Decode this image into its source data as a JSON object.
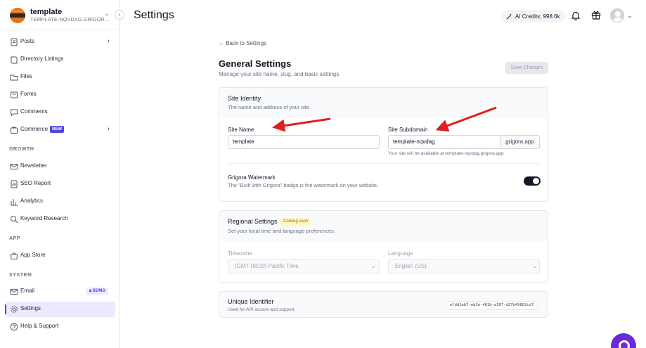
{
  "site": {
    "name": "template",
    "domain": "TEMPLATE-NQVDAG.GRIGOR..."
  },
  "nav": {
    "items_top": [
      {
        "label": "Posts",
        "icon": "posts-icon"
      },
      {
        "label": "Directory Listings",
        "icon": "book-icon"
      },
      {
        "label": "Files",
        "icon": "folder-icon"
      },
      {
        "label": "Forms",
        "icon": "forms-icon"
      },
      {
        "label": "Comments",
        "icon": "comment-icon"
      },
      {
        "label": "Commerce",
        "icon": "commerce-icon",
        "badge": "NEW"
      }
    ],
    "growth_label": "GROWTH",
    "growth": [
      {
        "label": "Newsletter",
        "icon": "mail-icon"
      },
      {
        "label": "SEO Report",
        "icon": "seo-icon"
      },
      {
        "label": "Analytics",
        "icon": "chart-icon"
      },
      {
        "label": "Keyword Research",
        "icon": "search-icon"
      }
    ],
    "app_label": "APP",
    "app": [
      {
        "label": "App Store",
        "icon": "store-icon"
      }
    ],
    "system_label": "SYSTEM",
    "system": [
      {
        "label": "Email",
        "icon": "mail-icon",
        "badge": "$5/MO"
      },
      {
        "label": "Settings",
        "icon": "gear-icon",
        "active": true
      },
      {
        "label": "Help & Support",
        "icon": "help-icon"
      }
    ]
  },
  "header": {
    "title": "Settings",
    "credits": "AI Credits: 998.6k"
  },
  "main": {
    "back": "← Back to Settings",
    "title": "General Settings",
    "subtitle": "Manage your site name, slug, and basic settings",
    "save": "Save Changes"
  },
  "identity": {
    "title": "Site Identity",
    "subtitle": "The name and address of your site.",
    "name_label": "Site Name",
    "name_value": "template",
    "subdomain_label": "Site Subdomain",
    "subdomain_value": "template-nqvdag",
    "subdomain_suffix": ".grigora.app",
    "subdomain_hint": "Your site will be available at template-nqvdag.grigora.app",
    "watermark_title": "Grigora Watermark",
    "watermark_desc": "The \"Built with Grigora\" badge is the watermark on your website.",
    "watermark_on": true
  },
  "regional": {
    "title": "Regional Settings",
    "badge": "Coming soon",
    "subtitle": "Set your local time and language preferences.",
    "timezone_label": "Timezone",
    "timezone_value": "(GMT-08:00) Pacific Time",
    "language_label": "Language",
    "language_value": "English (US)"
  },
  "uid": {
    "title": "Unique Identifier",
    "subtitle": "Used for API access and support.",
    "value": "efdd1eb7-eb3e-481b-a307-d27b49802cd7"
  },
  "colors": {
    "accent": "#4f46e5",
    "annotation_arrow": "#e02020",
    "help_bubble": "#6d28d9"
  }
}
